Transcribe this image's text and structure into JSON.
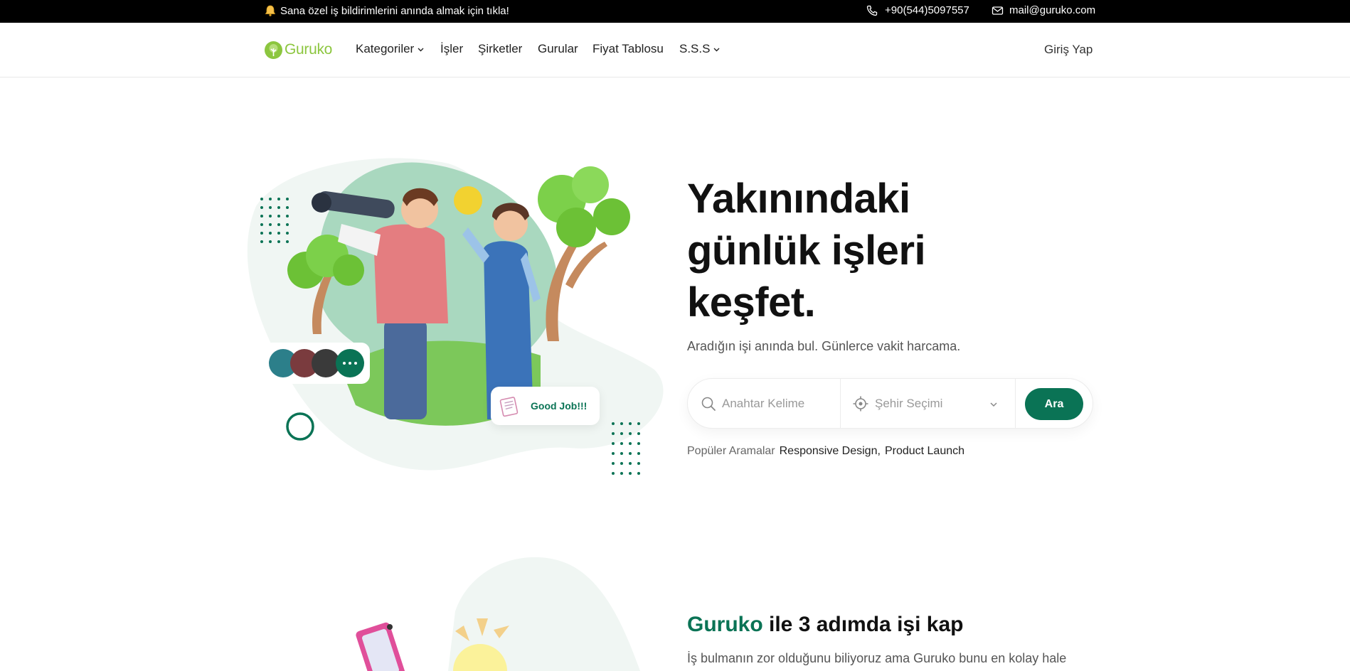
{
  "topbar": {
    "notice": "Sana özel iş bildirimlerini anında almak için tıkla!",
    "phone": "+90(544)5097557",
    "email": "mail@guruko.com"
  },
  "nav": {
    "brand": "Guruko",
    "items": [
      {
        "label": "Kategoriler",
        "dropdown": true
      },
      {
        "label": "İşler",
        "dropdown": false
      },
      {
        "label": "Şirketler",
        "dropdown": false
      },
      {
        "label": "Gurular",
        "dropdown": false
      },
      {
        "label": "Fiyat Tablosu",
        "dropdown": false
      },
      {
        "label": "S.S.S",
        "dropdown": true
      }
    ],
    "login": "Giriş Yap"
  },
  "hero": {
    "title": "Yakınındaki günlük işleri keşfet.",
    "subtitle": "Aradığın işi anında bul. Günlerce vakit harcama.",
    "search": {
      "keyword_placeholder": "Anahtar Kelime",
      "city_placeholder": "Şehir Seçimi",
      "button": "Ara"
    },
    "popular_label": "Popüler Aramalar",
    "popular_tags": [
      "Responsive Design",
      "Product Launch"
    ],
    "badge_text": "Good Job!!!"
  },
  "section2": {
    "brand": "Guruko",
    "title_rest": " ile 3 adımda işi kap",
    "text": "İş bulmanın zor olduğunu biliyoruz ama Guruko bunu en kolay hale getirir."
  },
  "colors": {
    "accent": "#0a7355",
    "brand_green": "#8cc63f",
    "topbar_bg": "#000000"
  }
}
